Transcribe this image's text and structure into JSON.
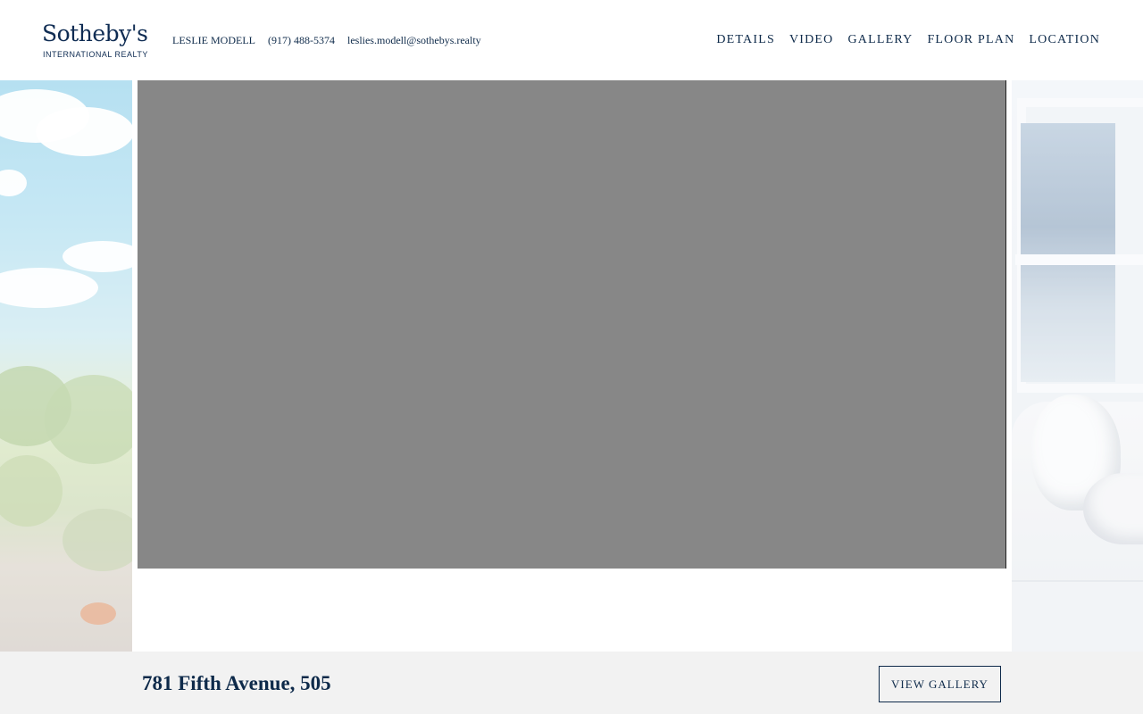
{
  "brand": {
    "logo_word": "Sotheby's",
    "logo_sub": "INTERNATIONAL REALTY",
    "color": "#0f2c53"
  },
  "agent": {
    "name": "LESLIE MODELL",
    "phone": "(917) 488-5374",
    "email": "leslies.modell@sothebys.realty"
  },
  "nav": {
    "items": [
      {
        "label": "DETAILS"
      },
      {
        "label": "VIDEO"
      },
      {
        "label": "GALLERY"
      },
      {
        "label": "FLOOR PLAN"
      },
      {
        "label": "LOCATION"
      }
    ]
  },
  "footer": {
    "address": "781 Fifth Avenue, 505",
    "view_gallery_label": "VIEW GALLERY"
  },
  "colors": {
    "text": "#0e2a4a",
    "slide_placeholder": "#878787",
    "footer_bg": "#f2f2f2"
  }
}
